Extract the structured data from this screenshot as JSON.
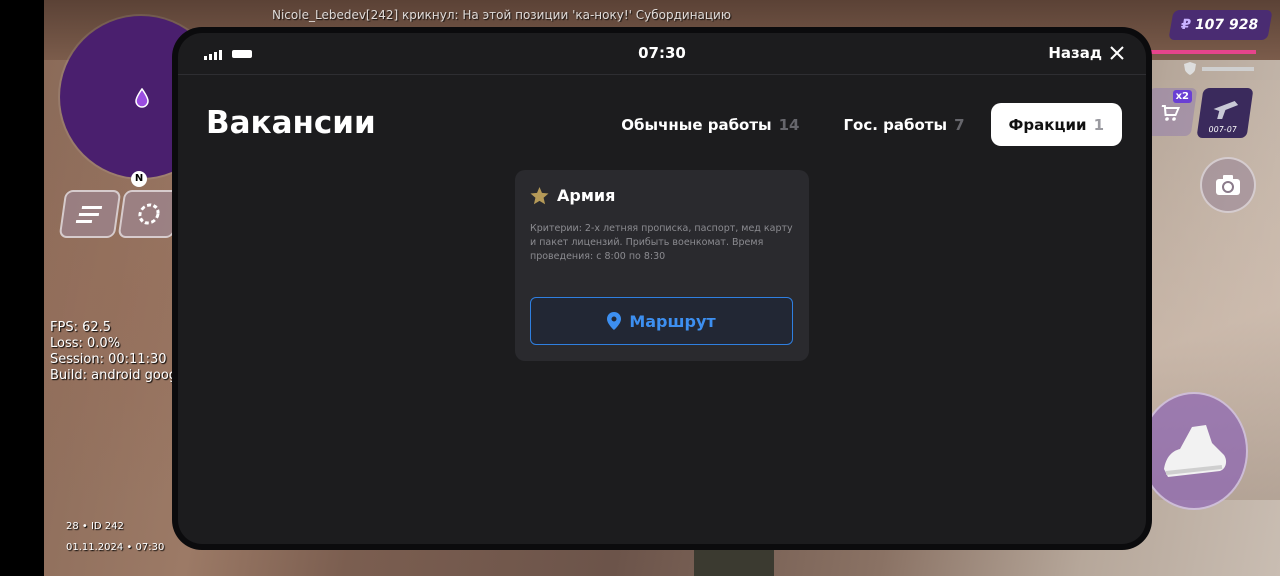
{
  "game": {
    "chat_line": "Nicole_Lebedev[242] крикнул: На этой позиции 'ка-ноку!' Субординацию",
    "minimap_north": "N",
    "stats": {
      "fps": "FPS: 62.5",
      "loss": "Loss: 0.0%",
      "session": "Session: 00:11:30",
      "build": "Build: android goog"
    },
    "footer": {
      "player": "28 • ID 242",
      "datetime": "01.11.2024 • 07:30"
    },
    "money": {
      "symbol": "₽",
      "amount": "107 928"
    },
    "shop_badge": "x2",
    "weapon_label": "007-07",
    "colors": {
      "hud_purple": "#4a2c72",
      "health": "#e6448c"
    }
  },
  "phone": {
    "status": {
      "time": "07:30",
      "back_label": "Назад"
    },
    "title": "Вакансии",
    "tabs": [
      {
        "label": "Обычные работы",
        "count": "14"
      },
      {
        "label": "Гос. работы",
        "count": "7"
      },
      {
        "label": "Фракции",
        "count": "1"
      }
    ],
    "active_tab": "Фракции",
    "vacancy": {
      "icon": "star-icon",
      "title": "Армия",
      "description": "Критерии: 2-х летняя прописка, паспорт, мед карту и пакет лицензий. Прибыть военкомат. Время проведения: с 8:00 по 8:30",
      "route_label": "Маршрут",
      "route_icon": "map-pin-icon"
    },
    "colors": {
      "accent": "#2f7fe0",
      "star": "#b59a58",
      "background": "#1c1c1e"
    }
  }
}
